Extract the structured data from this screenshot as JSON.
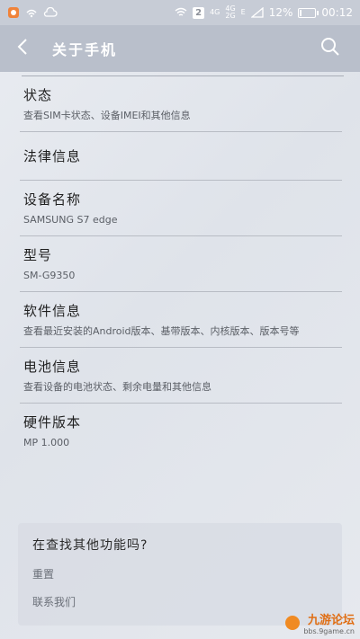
{
  "status_bar": {
    "sim_badge": "2",
    "network_4g_top": "4G",
    "network_4g_2g_top": "4G",
    "network_4g_2g_bottom": "2G",
    "network_e": "E",
    "battery_percent_text": "12%",
    "battery_level": 0.12,
    "time": "00:12",
    "icons": [
      "app-notification-icon",
      "wifi-signal-icon",
      "cloud-icon",
      "wifi-icon",
      "signal-icon",
      "battery-icon"
    ]
  },
  "app_bar": {
    "title": "关于手机",
    "back_icon": "chevron-left-icon",
    "search_icon": "search-icon"
  },
  "items": [
    {
      "title": "状态",
      "subtitle": "查看SIM卡状态、设备IMEI和其他信息"
    },
    {
      "title": "法律信息",
      "subtitle": ""
    },
    {
      "title": "设备名称",
      "subtitle": "SAMSUNG S7 edge"
    },
    {
      "title": "型号",
      "subtitle": "SM-G9350"
    },
    {
      "title": "软件信息",
      "subtitle": "查看最近安装的Android版本、基带版本、内核版本、版本号等"
    },
    {
      "title": "电池信息",
      "subtitle": "查看设备的电池状态、剩余电量和其他信息"
    },
    {
      "title": "硬件版本",
      "subtitle": "MP 1.000"
    }
  ],
  "help_card": {
    "title": "在查找其他功能吗?",
    "link_reset": "重置",
    "link_contact": "联系我们"
  },
  "watermark": {
    "title": "九游论坛",
    "url": "bbs.9game.cn"
  },
  "colors": {
    "app_bar": "#b9bfcb",
    "status_bar": "#c7ccd6",
    "watermark_accent": "#e06e14"
  }
}
